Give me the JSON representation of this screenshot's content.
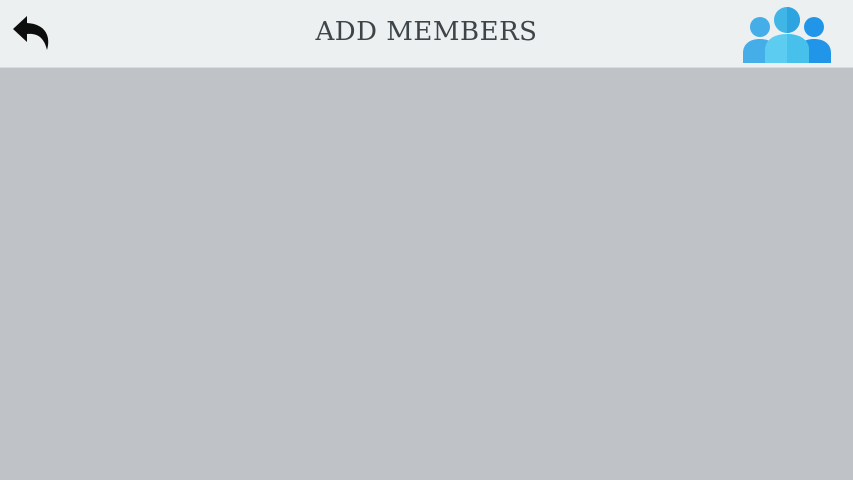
{
  "header": {
    "title": "ADD MEMBERS",
    "back_icon": "reply-arrow-icon",
    "members_icon": "group-icon"
  },
  "colors": {
    "header_bg": "#ecf0f1",
    "content_bg": "#bfc3c7",
    "title_text": "#3d4549",
    "group_icon_light": "#5ec6e8",
    "group_icon_dark": "#2f9fe6"
  },
  "content": {
    "members": []
  }
}
